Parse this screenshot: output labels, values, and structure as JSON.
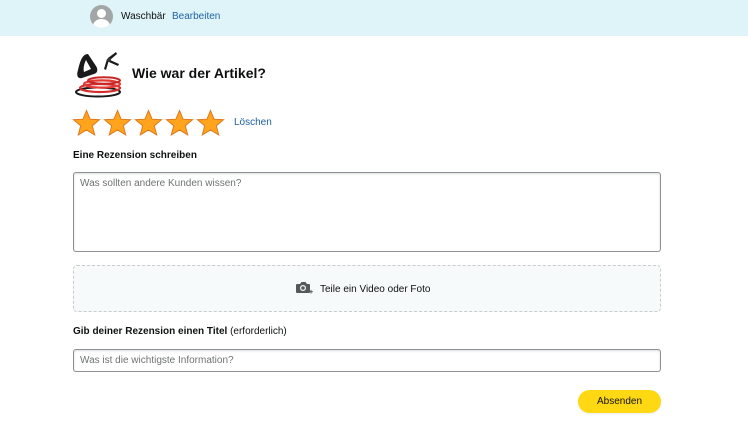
{
  "header": {
    "username": "Waschbär",
    "edit_label": "Bearbeiten",
    "avatar_icon": "user-avatar-icon",
    "background_color": "#def4f8"
  },
  "product": {
    "thumbnail_icon": "product-thumbnail",
    "question": "Wie war der Artikel?"
  },
  "rating": {
    "max_stars": 5,
    "selected_stars": 5,
    "star_icon": "star-icon",
    "star_color": "#ffa41c",
    "clear_label": "Löschen"
  },
  "review": {
    "label": "Eine Rezension schreiben",
    "value": "",
    "placeholder": "Was sollten andere Kunden wissen?"
  },
  "media": {
    "icon": "camera-icon",
    "label": "Teile ein Video oder Foto"
  },
  "title_field": {
    "label": "Gib deiner Rezension einen Titel",
    "label_hint": "(erforderlich)",
    "value": "",
    "placeholder": "Was ist die wichtigste Information?"
  },
  "submit": {
    "label": "Absenden",
    "color": "#ffd814"
  },
  "colors": {
    "link": "#2162a1",
    "text": "#0f1111"
  }
}
